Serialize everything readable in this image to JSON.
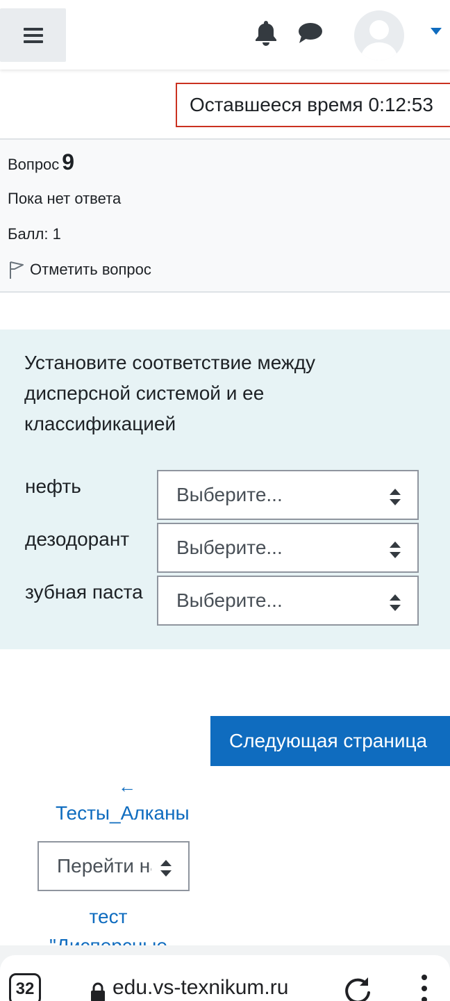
{
  "navbar": {
    "menu_icon": "hamburger-icon",
    "notifications_icon": "bell-icon",
    "messages_icon": "chat-icon",
    "avatar_icon": "user-avatar",
    "dropdown_icon": "caret-down-icon"
  },
  "timer": {
    "text": "Оставшееся время 0:12:53"
  },
  "question_info": {
    "label": "Вопрос",
    "number": "9",
    "state": "Пока нет ответа",
    "grade": "Балл: 1",
    "flag_label": "Отметить вопрос"
  },
  "question": {
    "text": "Установите соответствие между дисперсной системой и ее классификацией",
    "rows": [
      {
        "label": "нефть",
        "select_value": "Выберите..."
      },
      {
        "label": "дезодорант",
        "select_value": "Выберите..."
      },
      {
        "label": "зубная паста",
        "select_value": "Выберите..."
      }
    ]
  },
  "navigation": {
    "next_button": "Следующая страница",
    "prev_arrow": "←",
    "prev_link": "Тесты_Алканы",
    "jump_select": "Перейти на...",
    "next_link": "тест \"Дисперсные"
  },
  "browser": {
    "tab_count": "32",
    "url": "edu.vs-texnikum.ru"
  },
  "colors": {
    "accent": "#0f6cbf",
    "timer_border": "#ca3120",
    "question_bg": "#e7f3f5",
    "info_bg": "#f8f9fa"
  }
}
